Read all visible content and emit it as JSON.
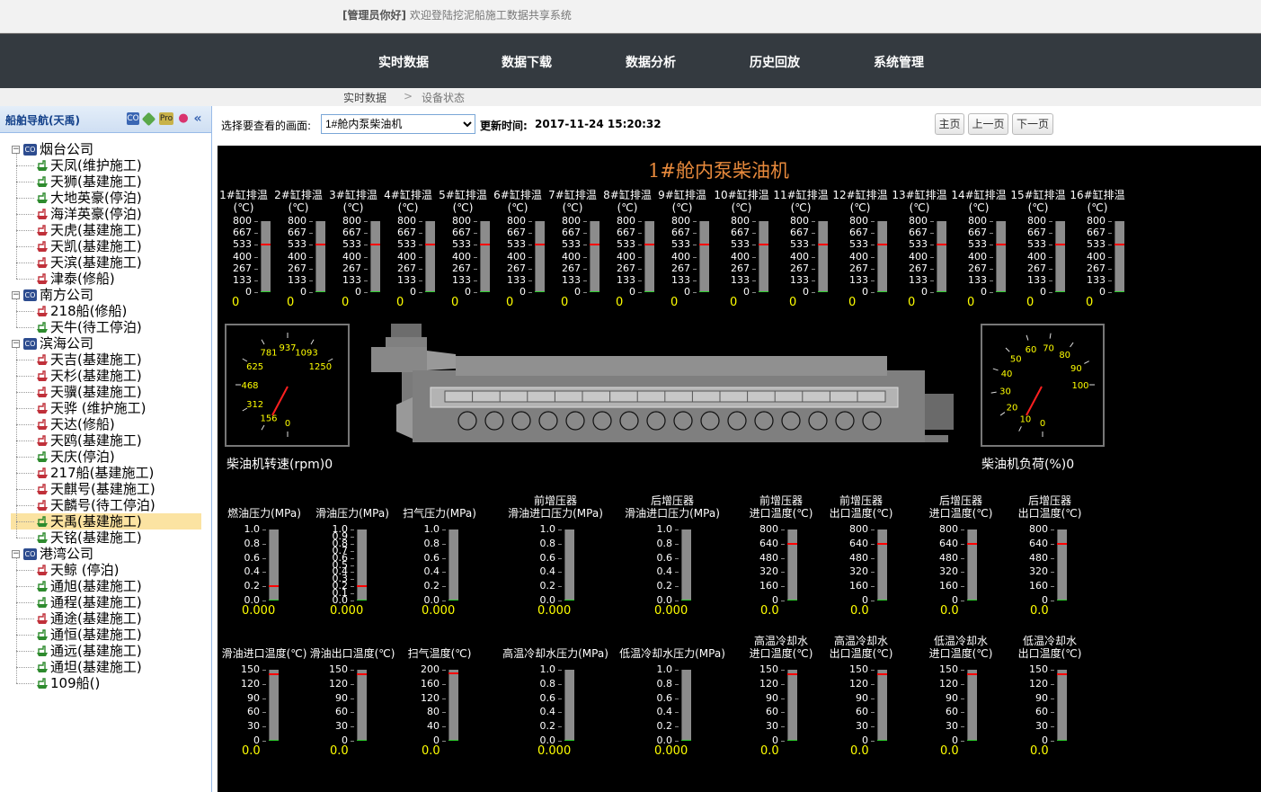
{
  "topbar": {
    "greeting": "[管理员你好]",
    "welcome": "欢迎登陆挖泥船施工数据共享系统"
  },
  "nav": {
    "items": [
      "实时数据",
      "数据下载",
      "数据分析",
      "历史回放",
      "系统管理"
    ]
  },
  "breadcrumb": {
    "first": "实时数据",
    "sep": ">",
    "second": "设备状态"
  },
  "sidebar": {
    "title": "船舶导航(天禹)",
    "icons": [
      "co-icon",
      "ship-icon",
      "pro-icon",
      "location-pin-icon",
      "collapse-icon"
    ],
    "groups": [
      {
        "name": "烟台公司",
        "ships": [
          "天凤(维护施工)",
          "天狮(基建施工)",
          "大地英豪(停泊)",
          "海洋英豪(停泊)",
          "天虎(基建施工)",
          "天凯(基建施工)",
          "天滨(基建施工)",
          "津泰(修船)"
        ]
      },
      {
        "name": "南方公司",
        "ships": [
          "218船(修船)",
          "天牛(待工停泊)"
        ]
      },
      {
        "name": "滨海公司",
        "ships": [
          "天吉(基建施工)",
          "天杉(基建施工)",
          "天骥(基建施工)",
          "天骅 (维护施工)",
          "天达(修船)",
          "天鸥(基建施工)",
          "天庆(停泊)",
          "217船(基建施工)",
          "天麒号(基建施工)",
          "天麟号(待工停泊)",
          "天禹(基建施工)",
          "天铭(基建施工)"
        ]
      },
      {
        "name": "港湾公司",
        "ships": [
          "天鲸 (停泊)",
          "通旭(基建施工)",
          "通程(基建施工)",
          "通途(基建施工)",
          "通恒(基建施工)",
          "通远(基建施工)",
          "通坦(基建施工)",
          "109船()"
        ]
      }
    ],
    "selected": "天禹(基建施工)"
  },
  "toolbar": {
    "select_label": "选择要查看的画面:",
    "selected_screen": "1#舱内泵柴油机",
    "update_label": "更新时间:",
    "update_time": "2017-11-24 15:20:32",
    "home": "主页",
    "prev": "上一页",
    "next": "下一页"
  },
  "screen": {
    "title": "1#舱内泵柴油机",
    "cylinders": {
      "labels": [
        "1#缸排温",
        "2#缸排温",
        "3#缸排温",
        "4#缸排温",
        "5#缸排温",
        "6#缸排温",
        "7#缸排温",
        "8#缸排温",
        "9#缸排温",
        "10#缸排温",
        "11#缸排温",
        "12#缸排温",
        "13#缸排温",
        "14#缸排温",
        "15#缸排温",
        "16#缸排温"
      ],
      "unit": "(℃)",
      "ticks": [
        "800",
        "667",
        "533",
        "400",
        "267",
        "133",
        "0"
      ],
      "alarm_level": 533,
      "max": 800,
      "values": [
        "0",
        "0",
        "0",
        "0",
        "0",
        "0",
        "0",
        "0",
        "0",
        "0",
        "0",
        "0",
        "0",
        "0",
        "0",
        "0"
      ]
    },
    "rpm_gauge": {
      "ticks": [
        "0",
        "156",
        "312",
        "468",
        "625",
        "781",
        "937",
        "1093",
        "1250"
      ],
      "label": "柴油机转速(rpm)",
      "value": "0"
    },
    "load_gauge": {
      "ticks": [
        "0",
        "10",
        "20",
        "30",
        "40",
        "50",
        "60",
        "70",
        "80",
        "90",
        "100"
      ],
      "label": "柴油机负荷(%)",
      "value": "0"
    },
    "row1": [
      {
        "label1": "",
        "label2": "燃油压力(MPa)",
        "ticks": [
          "1.0",
          "0.8",
          "0.6",
          "0.4",
          "0.2",
          "0.0"
        ],
        "alarm": 0.2,
        "max": 1.0,
        "value": "0.000"
      },
      {
        "label1": "",
        "label2": "滑油压力(MPa)",
        "ticks": [
          "1.0",
          "0.9",
          "0.8",
          "0.7",
          "0.6",
          "0.5",
          "0.4",
          "0.3",
          "0.2",
          "0.1",
          "0.0"
        ],
        "alarm": 0.2,
        "max": 1.0,
        "value": "0.000"
      },
      {
        "label1": "",
        "label2": "扫气压力(MPa)",
        "ticks": [
          "1.0",
          "0.8",
          "0.6",
          "0.4",
          "0.2",
          "0.0"
        ],
        "alarm": null,
        "max": 1.0,
        "value": "0.000"
      },
      {
        "label1": "前增压器",
        "label2": "滑油进口压力(MPa)",
        "ticks": [
          "1.0",
          "0.8",
          "0.6",
          "0.4",
          "0.2",
          "0.0"
        ],
        "alarm": null,
        "max": 1.0,
        "value": "0.000"
      },
      {
        "label1": "后增压器",
        "label2": "滑油进口压力(MPa)",
        "ticks": [
          "1.0",
          "0.8",
          "0.6",
          "0.4",
          "0.2",
          "0.0"
        ],
        "alarm": null,
        "max": 1.0,
        "value": "0.000"
      },
      {
        "label1": "前增压器",
        "label2": "进口温度(℃)",
        "ticks": [
          "800",
          "640",
          "480",
          "320",
          "160",
          "0"
        ],
        "alarm": 640,
        "max": 800,
        "value": "0.0"
      },
      {
        "label1": "前增压器",
        "label2": "出口温度(℃)",
        "ticks": [
          "800",
          "640",
          "480",
          "320",
          "160",
          "0"
        ],
        "alarm": 640,
        "max": 800,
        "value": "0.0"
      },
      {
        "label1": "后增压器",
        "label2": "进口温度(℃)",
        "ticks": [
          "800",
          "640",
          "480",
          "320",
          "160",
          "0"
        ],
        "alarm": 640,
        "max": 800,
        "value": "0.0"
      },
      {
        "label1": "后增压器",
        "label2": "出口温度(℃)",
        "ticks": [
          "800",
          "640",
          "480",
          "320",
          "160",
          "0"
        ],
        "alarm": 640,
        "max": 800,
        "value": "0.0"
      }
    ],
    "row2": [
      {
        "label1": "",
        "label2": "滑油进口温度(℃)",
        "ticks": [
          "150",
          "120",
          "90",
          "60",
          "30",
          "0"
        ],
        "alarm": 140,
        "max": 150,
        "value": "0.0"
      },
      {
        "label1": "",
        "label2": "滑油出口温度(℃)",
        "ticks": [
          "150",
          "120",
          "90",
          "60",
          "30",
          "0"
        ],
        "alarm": 140,
        "max": 150,
        "value": "0.0"
      },
      {
        "label1": "",
        "label2": "扫气温度(℃)",
        "ticks": [
          "200",
          "160",
          "120",
          "80",
          "40",
          "0"
        ],
        "alarm": 190,
        "max": 200,
        "value": "0.0"
      },
      {
        "label1": "",
        "label2": "高温冷却水压力(MPa)",
        "ticks": [
          "1.0",
          "0.8",
          "0.6",
          "0.4",
          "0.2",
          "0.0"
        ],
        "alarm": null,
        "max": 1.0,
        "value": "0.000"
      },
      {
        "label1": "",
        "label2": "低温冷却水压力(MPa)",
        "ticks": [
          "1.0",
          "0.8",
          "0.6",
          "0.4",
          "0.2",
          "0.0"
        ],
        "alarm": null,
        "max": 1.0,
        "value": "0.000"
      },
      {
        "label1": "高温冷却水",
        "label2": "进口温度(℃)",
        "ticks": [
          "150",
          "120",
          "90",
          "60",
          "30",
          "0"
        ],
        "alarm": 140,
        "max": 150,
        "value": "0.0"
      },
      {
        "label1": "高温冷却水",
        "label2": "出口温度(℃)",
        "ticks": [
          "150",
          "120",
          "90",
          "60",
          "30",
          "0"
        ],
        "alarm": 140,
        "max": 150,
        "value": "0.0"
      },
      {
        "label1": "低温冷却水",
        "label2": "进口温度(℃)",
        "ticks": [
          "150",
          "120",
          "90",
          "60",
          "30",
          "0"
        ],
        "alarm": 140,
        "max": 150,
        "value": "0.0"
      },
      {
        "label1": "低温冷却水",
        "label2": "出口温度(℃)",
        "ticks": [
          "150",
          "120",
          "90",
          "60",
          "30",
          "0"
        ],
        "alarm": 140,
        "max": 150,
        "value": "0.0"
      }
    ]
  }
}
